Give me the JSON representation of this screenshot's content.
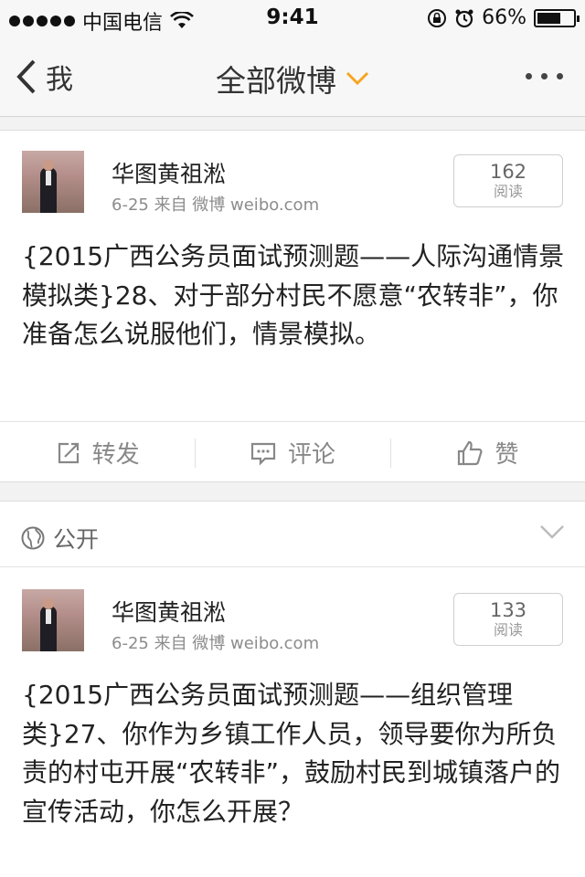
{
  "status_bar": {
    "carrier": "中国电信",
    "time": "9:41",
    "battery": "66%",
    "battery_level": 0.66
  },
  "nav": {
    "back_label": "我",
    "title": "全部微博",
    "accent_color": "#f5a623"
  },
  "posts": [
    {
      "username": "华图黄祖淞",
      "meta": "6-25  来自 微博 weibo.com",
      "read_count": "162",
      "read_label": "阅读",
      "text": "{2015广西公务员面试预测题——人际沟通情景模拟类}28、对于部分村民不愿意“农转非”，你准备怎么说服他们，情景模拟。",
      "actions": {
        "repost": "转发",
        "comment": "评论",
        "like": "赞"
      }
    },
    {
      "visibility": "公开",
      "username": "华图黄祖淞",
      "meta": "6-25  来自 微博 weibo.com",
      "read_count": "133",
      "read_label": "阅读",
      "text": "{2015广西公务员面试预测题——组织管理类}27、你作为乡镇工作人员，领导要你为所负责的村屯开展“农转非”，鼓励村民到城镇落户的宣传活动，你怎么开展？"
    }
  ]
}
